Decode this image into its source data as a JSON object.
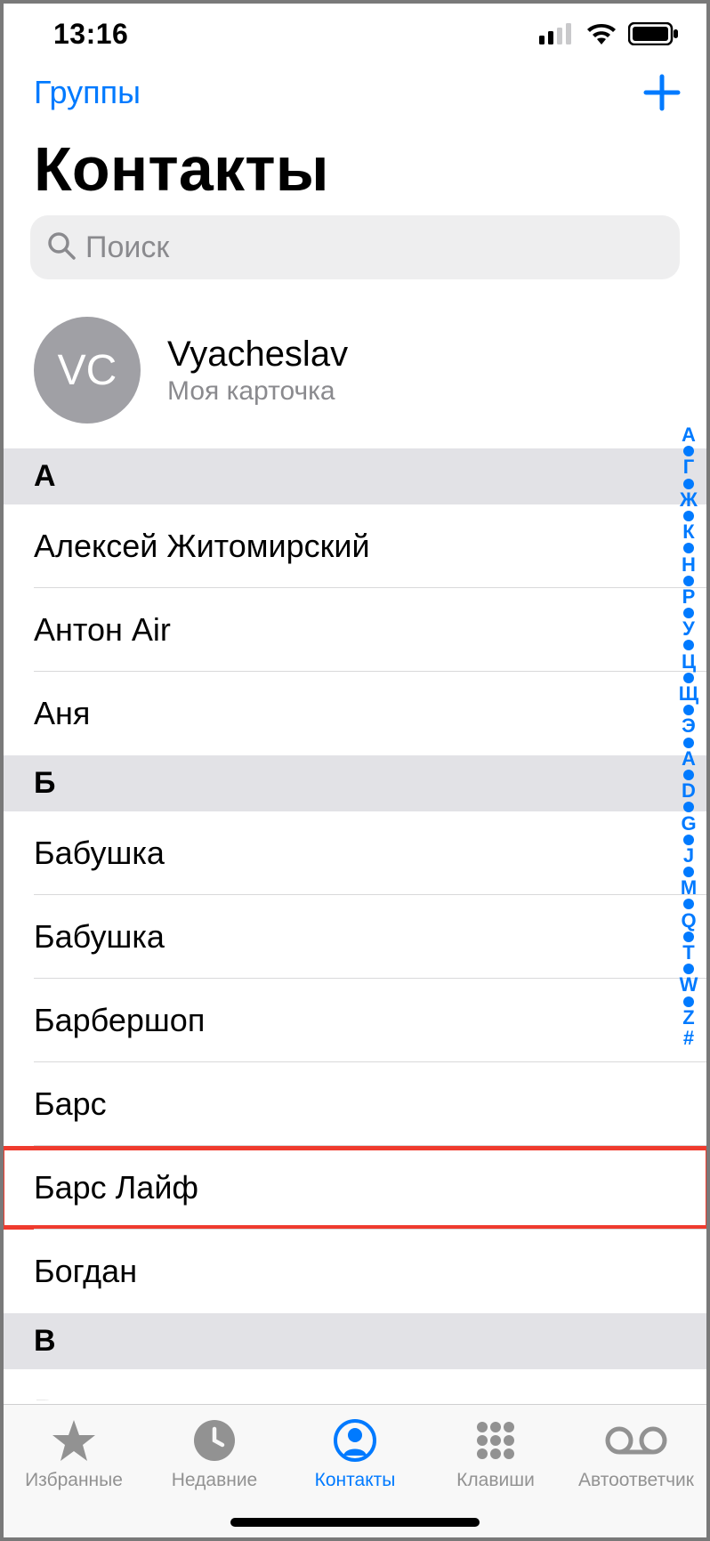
{
  "status": {
    "time": "13:16"
  },
  "nav": {
    "groups_label": "Группы"
  },
  "title": "Контакты",
  "search": {
    "placeholder": "Поиск"
  },
  "my_card": {
    "initials": "VC",
    "name": "Vyacheslav",
    "subtitle": "Моя карточка"
  },
  "sections": {
    "a": {
      "header": "А",
      "rows": [
        "Алексей Житомирский",
        "Антон Air",
        "Аня"
      ]
    },
    "b": {
      "header": "Б",
      "rows": [
        "Бабушка",
        "Бабушка",
        "Барбершоп",
        "Барс",
        "Барс Лайф",
        "Богдан"
      ],
      "highlight_index": 4
    },
    "v": {
      "header": "В",
      "rows": [
        "Вадим"
      ]
    }
  },
  "index_bar": [
    "А",
    "•",
    "Г",
    "•",
    "Ж",
    "•",
    "К",
    "•",
    "Н",
    "•",
    "Р",
    "•",
    "У",
    "•",
    "Ц",
    "•",
    "Щ",
    "•",
    "Э",
    "•",
    "A",
    "•",
    "D",
    "•",
    "G",
    "•",
    "J",
    "•",
    "M",
    "•",
    "Q",
    "•",
    "T",
    "•",
    "W",
    "•",
    "Z",
    "#"
  ],
  "tabs": {
    "favorites": "Избранные",
    "recents": "Недавние",
    "contacts": "Контакты",
    "keypad": "Клавиши",
    "voicemail": "Автоответчик"
  }
}
